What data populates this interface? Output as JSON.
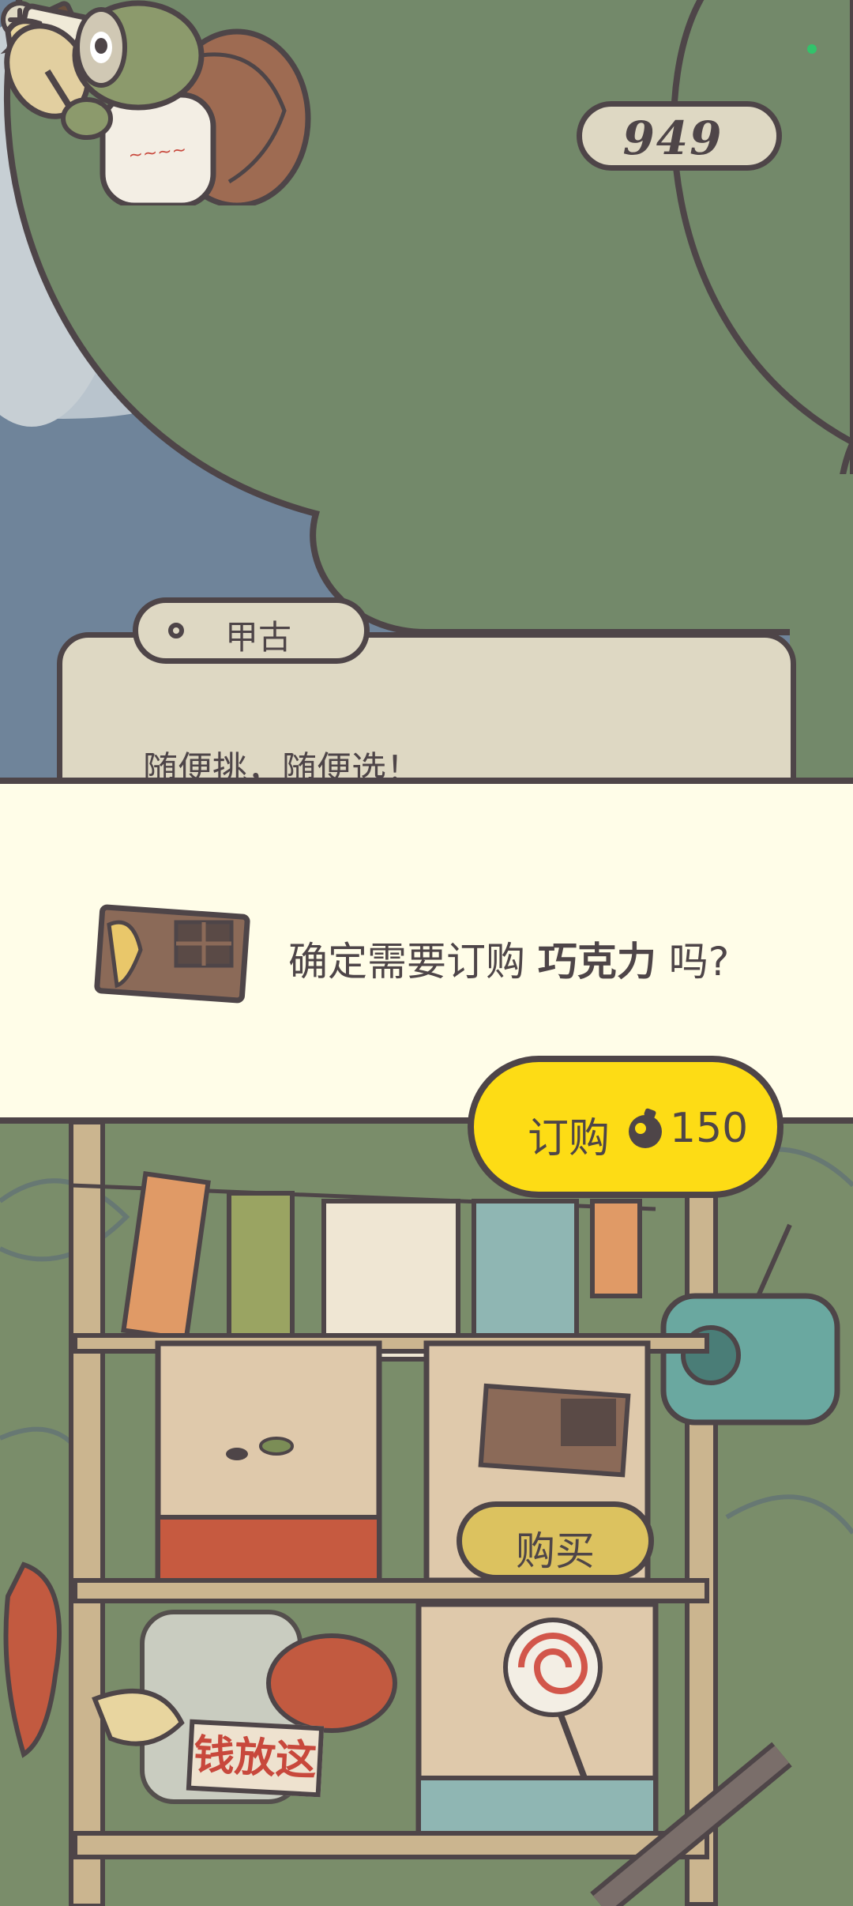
{
  "hud": {
    "acorn_count": "949",
    "acorn_icon": "acorn-icon",
    "add_icon": "plus-icon",
    "postcard_icon": "postcard-icon"
  },
  "dialog": {
    "speaker": "甲古",
    "text": "随便挑，随便选！"
  },
  "confirm": {
    "item_icon": "chocolate-icon",
    "text_before": "确定需要订购 ",
    "item_name": "巧克力",
    "text_after": " 吗?",
    "order_label": "订购",
    "price": "150"
  },
  "shop": {
    "buy_label": "购买",
    "sign": "钱放这"
  },
  "colors": {
    "outline": "#4e4548",
    "panel_bg": "#fffde8",
    "order_yellow": "#fddc15",
    "buy_gold": "#dcc25f",
    "dialog_bg": "#ded8c3",
    "tree_green": "#73896a"
  }
}
